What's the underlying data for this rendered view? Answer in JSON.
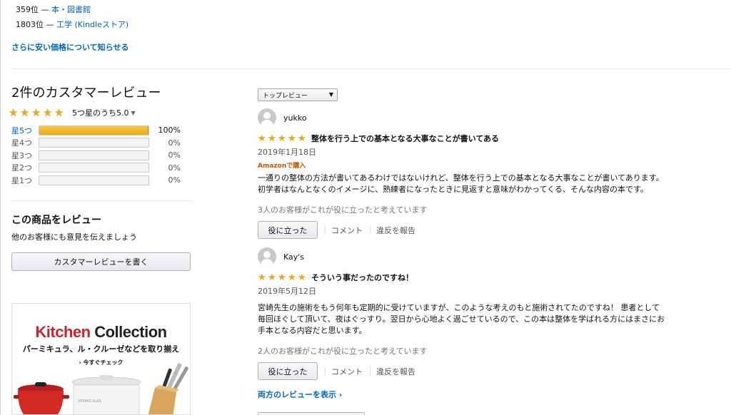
{
  "rankings": [
    {
      "rank": "359位 — ",
      "category": "本・図書館"
    },
    {
      "rank": "1803位 — ",
      "category": "工学 (Kindleストア)"
    }
  ],
  "notify_link": "さらに安い価格について知らせる",
  "summary": {
    "title": "2件のカスタマーレビュー",
    "rating_text": "5つ星のうち5.0",
    "histogram": [
      {
        "label": "星5つ",
        "pct_text": "100%",
        "fraction": 1.0
      },
      {
        "label": "星4つ",
        "pct_text": "0%",
        "fraction": 0
      },
      {
        "label": "星3つ",
        "pct_text": "0%",
        "fraction": 0
      },
      {
        "label": "星2つ",
        "pct_text": "0%",
        "fraction": 0
      },
      {
        "label": "星1つ",
        "pct_text": "0%",
        "fraction": 0
      }
    ]
  },
  "review_this": {
    "heading": "この商品をレビュー",
    "subtext": "他のお客様にも意見を伝えましょう",
    "button": "カスタマーレビューを書く"
  },
  "ad": {
    "title_part1": "Kitchen",
    "title_part2": "Collection",
    "subtitle": "パーミキュラ、ル・クルーゼなどを取り揃え",
    "cta": "› 今すぐチェック",
    "pot_label": "VERMICULAR"
  },
  "sort": {
    "selected": "トップレビュー"
  },
  "reviews": [
    {
      "user": "yukko",
      "title": "整体を行う上での基本となる大事なことが書いてある",
      "date": "2019年1月18日",
      "verified": "Amazonで購入",
      "body_lines": [
        "一通りの整体の方法が書いてあるわけではないけれど、整体を行う上での基本となる大事なことが書いてあります。",
        "初学者はなんとなくのイメージに、熟練者になったときに見返すと意味がわかってくる、そんな内容の本です。"
      ],
      "helpful": "3人のお客様がこれが役に立ったと考えています",
      "helpful_btn": "役に立った",
      "comment": "コメント",
      "report": "違反を報告",
      "stars": 5
    },
    {
      "user": "Kay's",
      "title": "そういう事だったのですね！",
      "date": "2019年5月12日",
      "verified": "",
      "body_lines": [
        "宮崎先生の施術をもう何年も定期的に受けていますが、このような考えのもと施術されてたのですね！ 患者として",
        "毎回ほぐして頂いて、夜はぐっすり。翌日から心地よく過ごせているので、この本は整体を学ばれる方にはまさにお",
        "手本となる内容だと思います。"
      ],
      "helpful": "2人のお客様がこれが役に立ったと考えています",
      "helpful_btn": "役に立った",
      "comment": "コメント",
      "report": "違反を報告",
      "stars": 5
    }
  ],
  "all_reviews_link": "両方のレビューを表示 ›",
  "colors": {
    "link": "#0066c0",
    "star": "#f0a81b",
    "verified": "#c45500"
  }
}
